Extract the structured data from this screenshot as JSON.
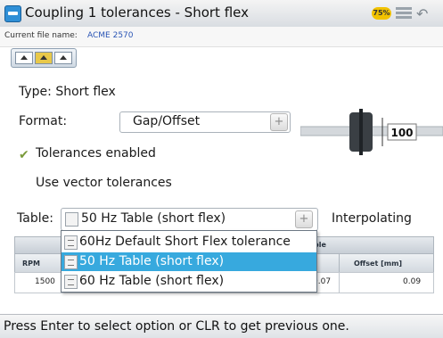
{
  "window": {
    "title": "Coupling 1 tolerances - Short flex",
    "battery_badge": "75%"
  },
  "file": {
    "label": "Current file name:",
    "name": "ACME 2570"
  },
  "form": {
    "type_label": "Type: Short flex",
    "format_label": "Format:",
    "format_value": "Gap/Offset",
    "tolerances_enabled_label": "Tolerances enabled",
    "tolerances_enabled_checked": true,
    "vector_tolerances_label": "Use vector tolerances",
    "vector_tolerances_checked": false,
    "table_label": "Table:",
    "table_value": "50 Hz Table (short flex)",
    "interpolating_label": "Interpolating",
    "coupling_value": "100"
  },
  "table": {
    "group_header": "ble",
    "columns": [
      "RPM",
      "Offset [mm]"
    ],
    "rows": [
      {
        "rpm": "1500",
        "offset_partial": "0.07",
        "offset": "0.09"
      }
    ]
  },
  "dropdown": {
    "options": [
      "60Hz Default Short Flex tolerance",
      "50 Hz Table (short flex)",
      "60 Hz Table (short flex)"
    ],
    "selected_index": 1
  },
  "status": {
    "text": "Press Enter to select option or CLR to get previous one."
  },
  "colors": {
    "selection": "#37a9de",
    "file_name": "#2a55b5",
    "check": "#7a9a3a"
  }
}
